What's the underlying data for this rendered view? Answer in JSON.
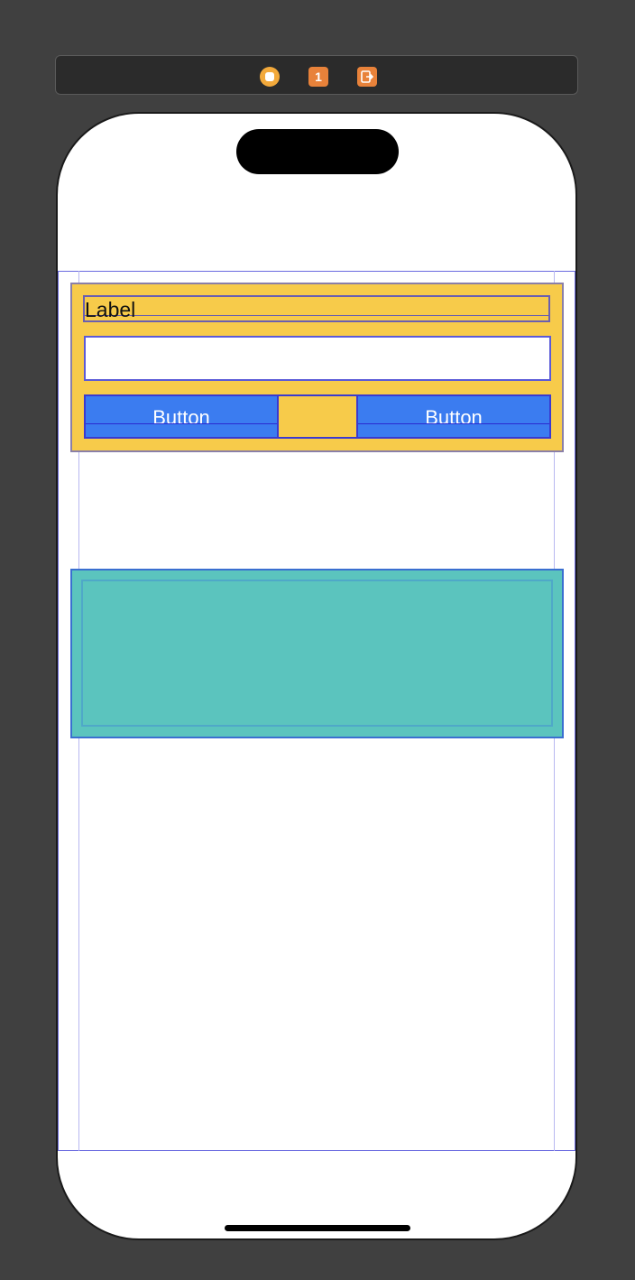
{
  "scene_dock": {
    "icons": [
      "view-controller-icon",
      "first-responder-icon",
      "exit-icon"
    ],
    "first_responder_glyph": "1"
  },
  "canvas": {
    "label": {
      "text": "Label"
    },
    "text_field": {
      "value": ""
    },
    "buttons": {
      "left_label": "Button",
      "right_label": "Button"
    }
  },
  "colors": {
    "background": "#404040",
    "stack_fill": "#f7cb4a",
    "button_fill": "#3b7cf0",
    "teal_view_fill": "#5bc4be",
    "constraint_blue": "#6a6ae0",
    "dock_orange": "#e8823a",
    "dock_yellow": "#f2a93b"
  }
}
